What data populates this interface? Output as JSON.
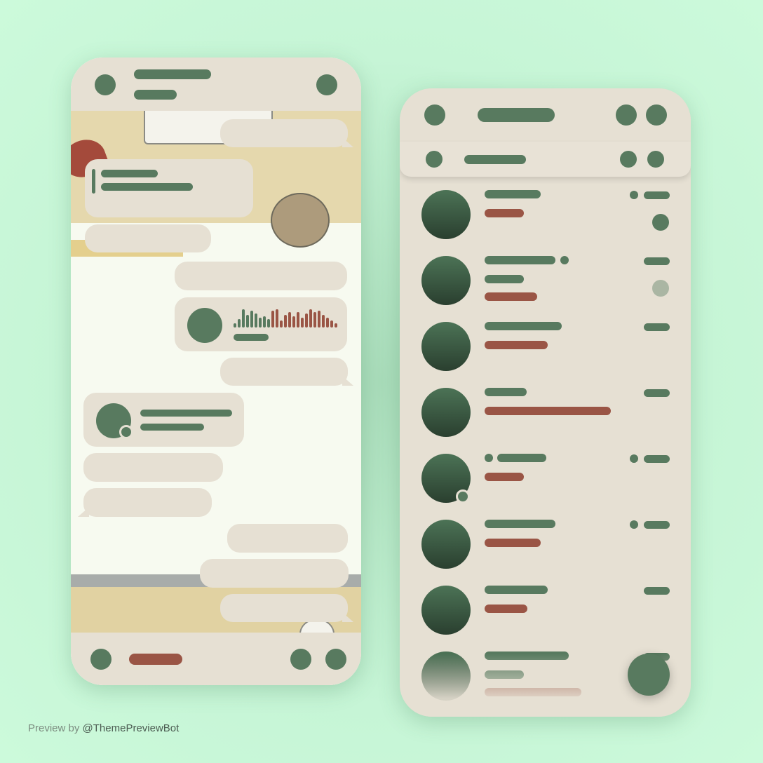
{
  "colors": {
    "background": "#c7f6d7",
    "panel": "#e6e0d3",
    "accent_green": "#587a5f",
    "accent_red": "#9a5545",
    "chat_wallpaper": "#f6f9ef"
  },
  "footer": {
    "prefix": "Preview by",
    "handle": "@ThemePreviewBot"
  }
}
